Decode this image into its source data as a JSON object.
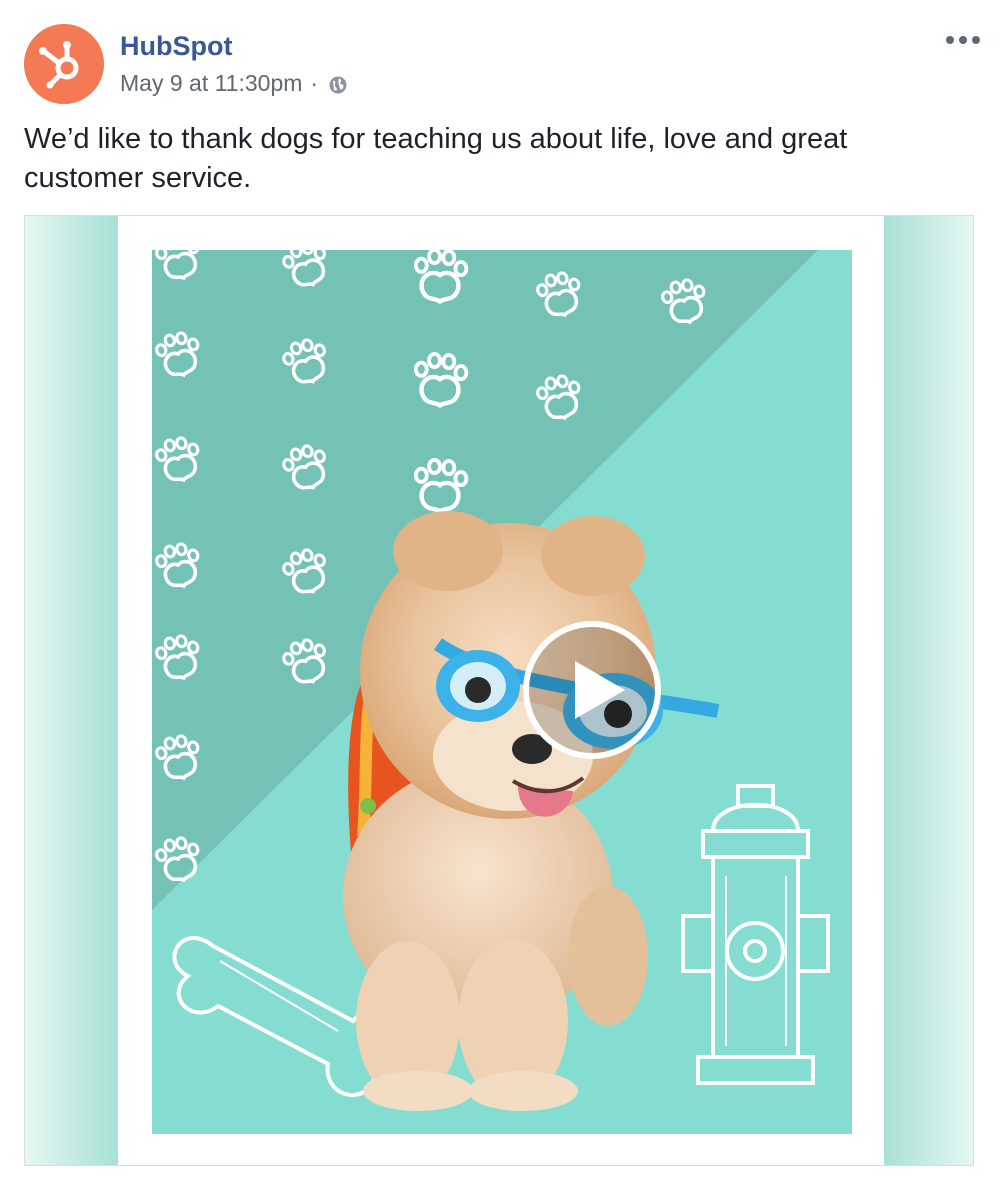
{
  "post": {
    "author": "HubSpot",
    "timestamp": "May 9 at 11:30pm",
    "separator": "·",
    "privacy_icon": "globe-icon",
    "more_icon": "more-options-icon",
    "text": "We’d like to thank dogs for teaching us about life, love and great customer service."
  },
  "media": {
    "type": "video",
    "play_icon": "play-icon",
    "colors": {
      "teal_dark": "#74c1b6",
      "teal_light": "#85ddd1",
      "frame": "#cdeee7"
    }
  },
  "colors": {
    "brand_orange": "#f47a56",
    "name_blue": "#385898",
    "meta_gray": "#606770"
  }
}
